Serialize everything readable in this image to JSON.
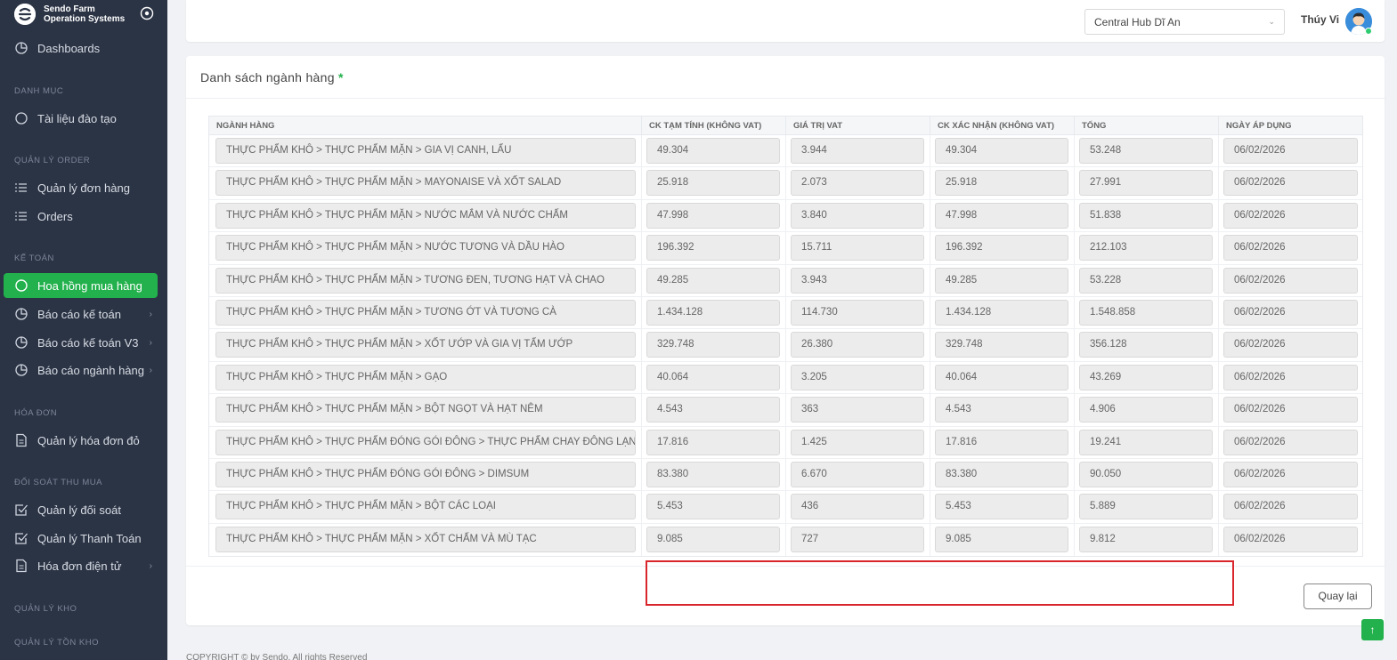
{
  "brand": {
    "line1": "Sendo Farm",
    "line2": "Operation Systems"
  },
  "nav": {
    "dashboards": "Dashboards",
    "section_danh_muc": "DANH MỤC",
    "tai_lieu": "Tài liệu đào tạo",
    "section_quan_ly_order": "QUẢN LÝ ORDER",
    "quan_ly_don_hang": "Quản lý đơn hàng",
    "orders": "Orders",
    "section_ke_toan": "KẾ TOÁN",
    "hoa_hong": "Hoa hồng mua hàng",
    "bao_cao_ke_toan": "Báo cáo kế toán",
    "bao_cao_ke_toan_v3": "Báo cáo kế toán V3",
    "bao_cao_nganh_hang": "Báo cáo ngành hàng",
    "section_hoa_don": "HÓA ĐƠN",
    "quan_ly_hoa_don_do": "Quản lý hóa đơn đỏ",
    "section_doi_soat": "ĐỐI SOÁT THU MUA",
    "quan_ly_doi_soat": "Quản lý đối soát",
    "quan_ly_thanh_toan": "Quản lý Thanh Toán",
    "hoa_don_dien_tu": "Hóa đơn điện tử",
    "section_quan_ly_kho": "QUẢN LÝ KHO",
    "section_quan_ly_ton_kho": "QUẢN LÝ TỒN KHO"
  },
  "header": {
    "hub": "Central Hub Dĩ An",
    "user": "Thúy Vi"
  },
  "card": {
    "title": "Danh sách ngành hàng",
    "required_mark": "*"
  },
  "table": {
    "columns": [
      "NGÀNH HÀNG",
      "CK TẠM TÍNH (KHÔNG VAT)",
      "GIÁ TRỊ VAT",
      "CK XÁC NHẬN (KHÔNG VAT)",
      "TỔNG",
      "NGÀY ÁP DỤNG"
    ],
    "rows": [
      [
        "THỰC PHẨM KHÔ > THỰC PHẨM MẶN > GIA VỊ CANH, LẨU",
        "49.304",
        "3.944",
        "49.304",
        "53.248",
        "06/02/2026"
      ],
      [
        "THỰC PHẨM KHÔ > THỰC PHẨM MẶN > MAYONAISE VÀ XỐT SALAD",
        "25.918",
        "2.073",
        "25.918",
        "27.991",
        "06/02/2026"
      ],
      [
        "THỰC PHẨM KHÔ > THỰC PHẨM MẶN > NƯỚC MẮM VÀ NƯỚC CHẤM",
        "47.998",
        "3.840",
        "47.998",
        "51.838",
        "06/02/2026"
      ],
      [
        "THỰC PHẨM KHÔ > THỰC PHẨM MẶN > NƯỚC TƯƠNG VÀ DẦU HÀO",
        "196.392",
        "15.711",
        "196.392",
        "212.103",
        "06/02/2026"
      ],
      [
        "THỰC PHẨM KHÔ > THỰC PHẨM MẶN > TƯƠNG ĐEN, TƯƠNG HẠT VÀ CHAO",
        "49.285",
        "3.943",
        "49.285",
        "53.228",
        "06/02/2026"
      ],
      [
        "THỰC PHẨM KHÔ > THỰC PHẨM MẶN > TƯƠNG ỚT VÀ TƯƠNG CÀ",
        "1.434.128",
        "114.730",
        "1.434.128",
        "1.548.858",
        "06/02/2026"
      ],
      [
        "THỰC PHẨM KHÔ > THỰC PHẨM MẶN > XỐT ƯỚP VÀ GIA VỊ TẨM ƯỚP",
        "329.748",
        "26.380",
        "329.748",
        "356.128",
        "06/02/2026"
      ],
      [
        "THỰC PHẨM KHÔ > THỰC PHẨM MẶN > GẠO",
        "40.064",
        "3.205",
        "40.064",
        "43.269",
        "06/02/2026"
      ],
      [
        "THỰC PHẨM KHÔ > THỰC PHẨM MẶN > BỘT NGỌT VÀ HẠT NÊM",
        "4.543",
        "363",
        "4.543",
        "4.906",
        "06/02/2026"
      ],
      [
        "THỰC PHẨM KHÔ > THỰC PHẨM ĐÓNG GÓI ĐÔNG > THỰC PHẨM CHAY ĐÔNG LẠNH",
        "17.816",
        "1.425",
        "17.816",
        "19.241",
        "06/02/2026"
      ],
      [
        "THỰC PHẨM KHÔ > THỰC PHẨM ĐÓNG GÓI ĐÔNG > DIMSUM",
        "83.380",
        "6.670",
        "83.380",
        "90.050",
        "06/02/2026"
      ],
      [
        "THỰC PHẨM KHÔ > THỰC PHẨM MẶN > BỘT CÁC LOẠI",
        "5.453",
        "436",
        "5.453",
        "5.889",
        "06/02/2026"
      ],
      [
        "THỰC PHẨM KHÔ > THỰC PHẨM MẶN > XỐT CHẤM VÀ MÙ TẠC",
        "9.085",
        "727",
        "9.085",
        "9.812",
        "06/02/2026"
      ]
    ]
  },
  "buttons": {
    "back": "Quay lại",
    "scroll_top": "↑"
  },
  "footer": {
    "copyright": "COPYRIGHT © by Sendo. All rights Reserved"
  },
  "colors": {
    "sidebar_bg": "#2b3445",
    "accent": "#22b14c",
    "highlight": "#d9262c"
  }
}
